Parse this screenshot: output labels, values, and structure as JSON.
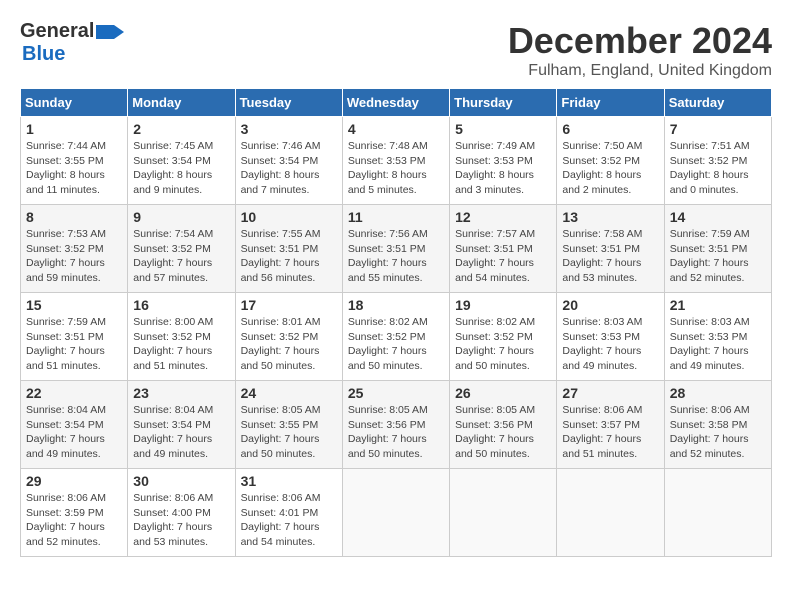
{
  "logo": {
    "line1": "General",
    "line2": "Blue"
  },
  "title": "December 2024",
  "subtitle": "Fulham, England, United Kingdom",
  "weekdays": [
    "Sunday",
    "Monday",
    "Tuesday",
    "Wednesday",
    "Thursday",
    "Friday",
    "Saturday"
  ],
  "weeks": [
    [
      {
        "day": "1",
        "sunrise": "7:44 AM",
        "sunset": "3:55 PM",
        "daylight": "8 hours and 11 minutes."
      },
      {
        "day": "2",
        "sunrise": "7:45 AM",
        "sunset": "3:54 PM",
        "daylight": "8 hours and 9 minutes."
      },
      {
        "day": "3",
        "sunrise": "7:46 AM",
        "sunset": "3:54 PM",
        "daylight": "8 hours and 7 minutes."
      },
      {
        "day": "4",
        "sunrise": "7:48 AM",
        "sunset": "3:53 PM",
        "daylight": "8 hours and 5 minutes."
      },
      {
        "day": "5",
        "sunrise": "7:49 AM",
        "sunset": "3:53 PM",
        "daylight": "8 hours and 3 minutes."
      },
      {
        "day": "6",
        "sunrise": "7:50 AM",
        "sunset": "3:52 PM",
        "daylight": "8 hours and 2 minutes."
      },
      {
        "day": "7",
        "sunrise": "7:51 AM",
        "sunset": "3:52 PM",
        "daylight": "8 hours and 0 minutes."
      }
    ],
    [
      {
        "day": "8",
        "sunrise": "7:53 AM",
        "sunset": "3:52 PM",
        "daylight": "7 hours and 59 minutes."
      },
      {
        "day": "9",
        "sunrise": "7:54 AM",
        "sunset": "3:52 PM",
        "daylight": "7 hours and 57 minutes."
      },
      {
        "day": "10",
        "sunrise": "7:55 AM",
        "sunset": "3:51 PM",
        "daylight": "7 hours and 56 minutes."
      },
      {
        "day": "11",
        "sunrise": "7:56 AM",
        "sunset": "3:51 PM",
        "daylight": "7 hours and 55 minutes."
      },
      {
        "day": "12",
        "sunrise": "7:57 AM",
        "sunset": "3:51 PM",
        "daylight": "7 hours and 54 minutes."
      },
      {
        "day": "13",
        "sunrise": "7:58 AM",
        "sunset": "3:51 PM",
        "daylight": "7 hours and 53 minutes."
      },
      {
        "day": "14",
        "sunrise": "7:59 AM",
        "sunset": "3:51 PM",
        "daylight": "7 hours and 52 minutes."
      }
    ],
    [
      {
        "day": "15",
        "sunrise": "7:59 AM",
        "sunset": "3:51 PM",
        "daylight": "7 hours and 51 minutes."
      },
      {
        "day": "16",
        "sunrise": "8:00 AM",
        "sunset": "3:52 PM",
        "daylight": "7 hours and 51 minutes."
      },
      {
        "day": "17",
        "sunrise": "8:01 AM",
        "sunset": "3:52 PM",
        "daylight": "7 hours and 50 minutes."
      },
      {
        "day": "18",
        "sunrise": "8:02 AM",
        "sunset": "3:52 PM",
        "daylight": "7 hours and 50 minutes."
      },
      {
        "day": "19",
        "sunrise": "8:02 AM",
        "sunset": "3:52 PM",
        "daylight": "7 hours and 50 minutes."
      },
      {
        "day": "20",
        "sunrise": "8:03 AM",
        "sunset": "3:53 PM",
        "daylight": "7 hours and 49 minutes."
      },
      {
        "day": "21",
        "sunrise": "8:03 AM",
        "sunset": "3:53 PM",
        "daylight": "7 hours and 49 minutes."
      }
    ],
    [
      {
        "day": "22",
        "sunrise": "8:04 AM",
        "sunset": "3:54 PM",
        "daylight": "7 hours and 49 minutes."
      },
      {
        "day": "23",
        "sunrise": "8:04 AM",
        "sunset": "3:54 PM",
        "daylight": "7 hours and 49 minutes."
      },
      {
        "day": "24",
        "sunrise": "8:05 AM",
        "sunset": "3:55 PM",
        "daylight": "7 hours and 50 minutes."
      },
      {
        "day": "25",
        "sunrise": "8:05 AM",
        "sunset": "3:56 PM",
        "daylight": "7 hours and 50 minutes."
      },
      {
        "day": "26",
        "sunrise": "8:05 AM",
        "sunset": "3:56 PM",
        "daylight": "7 hours and 50 minutes."
      },
      {
        "day": "27",
        "sunrise": "8:06 AM",
        "sunset": "3:57 PM",
        "daylight": "7 hours and 51 minutes."
      },
      {
        "day": "28",
        "sunrise": "8:06 AM",
        "sunset": "3:58 PM",
        "daylight": "7 hours and 52 minutes."
      }
    ],
    [
      {
        "day": "29",
        "sunrise": "8:06 AM",
        "sunset": "3:59 PM",
        "daylight": "7 hours and 52 minutes."
      },
      {
        "day": "30",
        "sunrise": "8:06 AM",
        "sunset": "4:00 PM",
        "daylight": "7 hours and 53 minutes."
      },
      {
        "day": "31",
        "sunrise": "8:06 AM",
        "sunset": "4:01 PM",
        "daylight": "7 hours and 54 minutes."
      },
      null,
      null,
      null,
      null
    ]
  ],
  "labels": {
    "sunrise": "Sunrise:",
    "sunset": "Sunset:",
    "daylight": "Daylight:"
  }
}
